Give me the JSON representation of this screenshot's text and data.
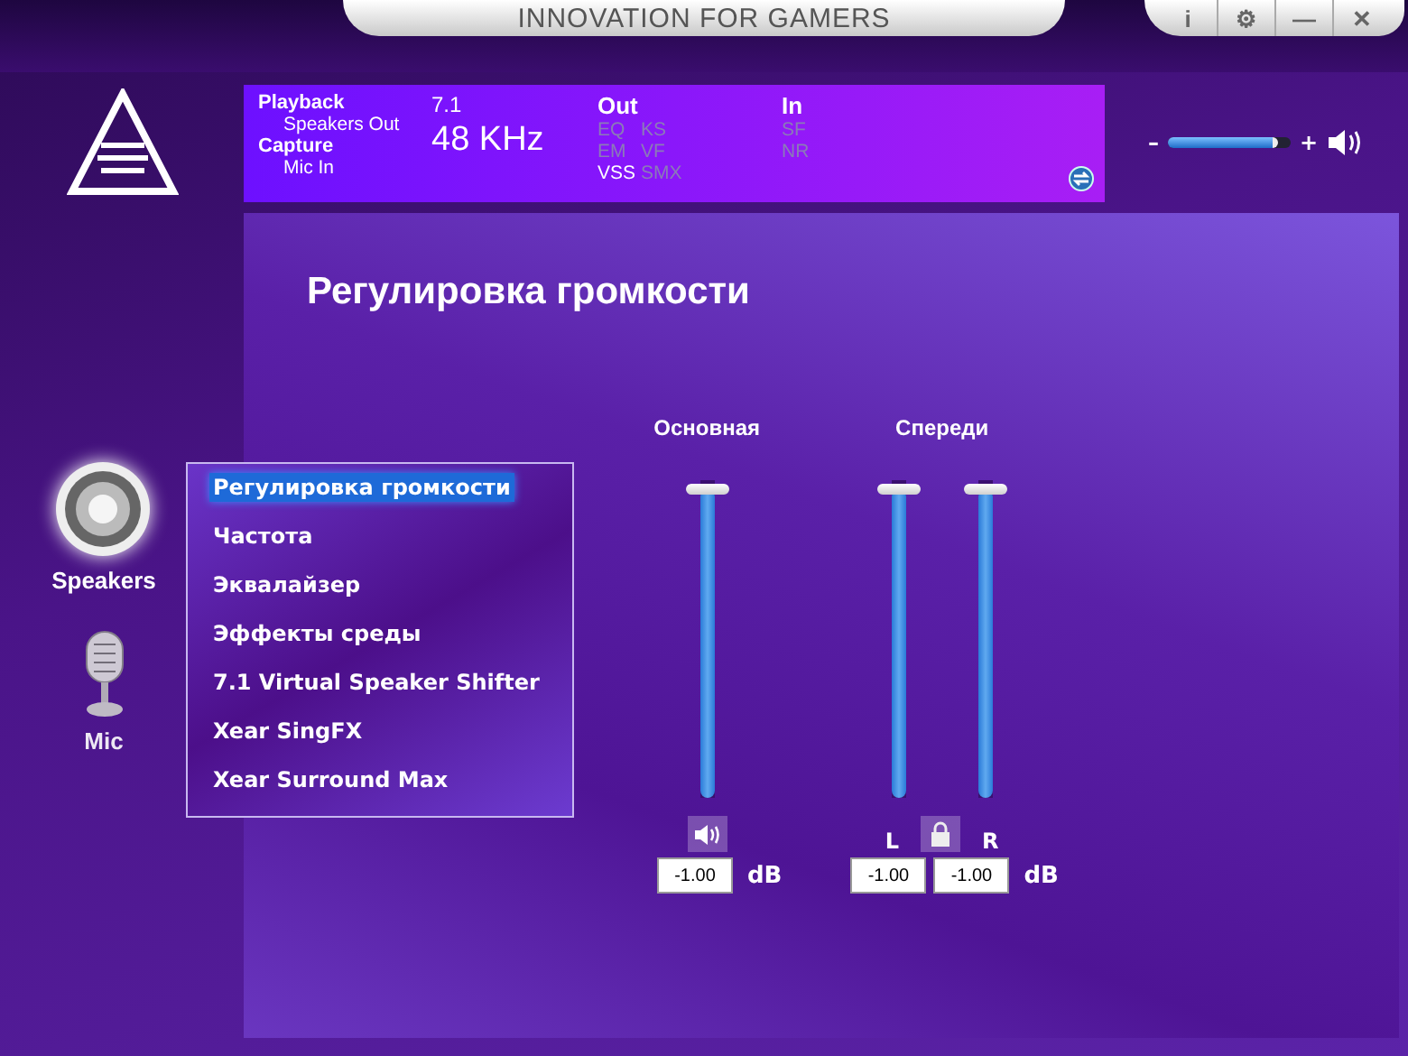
{
  "window": {
    "title": "INNOVATION FOR GAMERS",
    "controls": [
      "i",
      "⚙",
      "—",
      "✕"
    ]
  },
  "info": {
    "playback_label": "Playback",
    "playback_device": "Speakers Out",
    "capture_label": "Capture",
    "capture_device": "Mic In",
    "channels": "7.1",
    "rate": "48  KHz",
    "out_label": "Out",
    "out_effects": [
      {
        "label": "EQ",
        "on": false
      },
      {
        "label": "KS",
        "on": false
      },
      {
        "label": "EM",
        "on": false
      },
      {
        "label": "VF",
        "on": false
      },
      {
        "label": "VSS",
        "on": true
      },
      {
        "label": "SMX",
        "on": false
      }
    ],
    "in_label": "In",
    "in_effects": [
      {
        "label": "SF",
        "on": false
      },
      {
        "label": "NR",
        "on": false
      }
    ]
  },
  "master_volume": {
    "minus": "–",
    "plus": "+",
    "level": 0.9
  },
  "devices": [
    {
      "label": "Speakers",
      "kind": "speaker",
      "selected": true
    },
    {
      "label": "Mic",
      "kind": "mic",
      "selected": false
    }
  ],
  "menu": [
    {
      "label": "Регулировка громкости",
      "selected": true
    },
    {
      "label": "Частота",
      "selected": false
    },
    {
      "label": "Эквалайзер",
      "selected": false
    },
    {
      "label": "Эффекты среды",
      "selected": false
    },
    {
      "label": "7.1 Virtual Speaker Shifter",
      "selected": false
    },
    {
      "label": "Xear SingFX",
      "selected": false
    },
    {
      "label": "Xear Surround Max",
      "selected": false
    }
  ],
  "heading": "Регулировка громкости",
  "groups": [
    {
      "label": "Основная",
      "kind": "mute",
      "unit": "dB",
      "channels": [
        {
          "level": 0.97,
          "value": "-1.00"
        }
      ]
    },
    {
      "label": "Спереди",
      "kind": "lock",
      "unit": "dB",
      "channels": [
        {
          "name": "L",
          "level": 0.97,
          "value": "-1.00"
        },
        {
          "name": "R",
          "level": 0.97,
          "value": "-1.00"
        }
      ]
    }
  ]
}
